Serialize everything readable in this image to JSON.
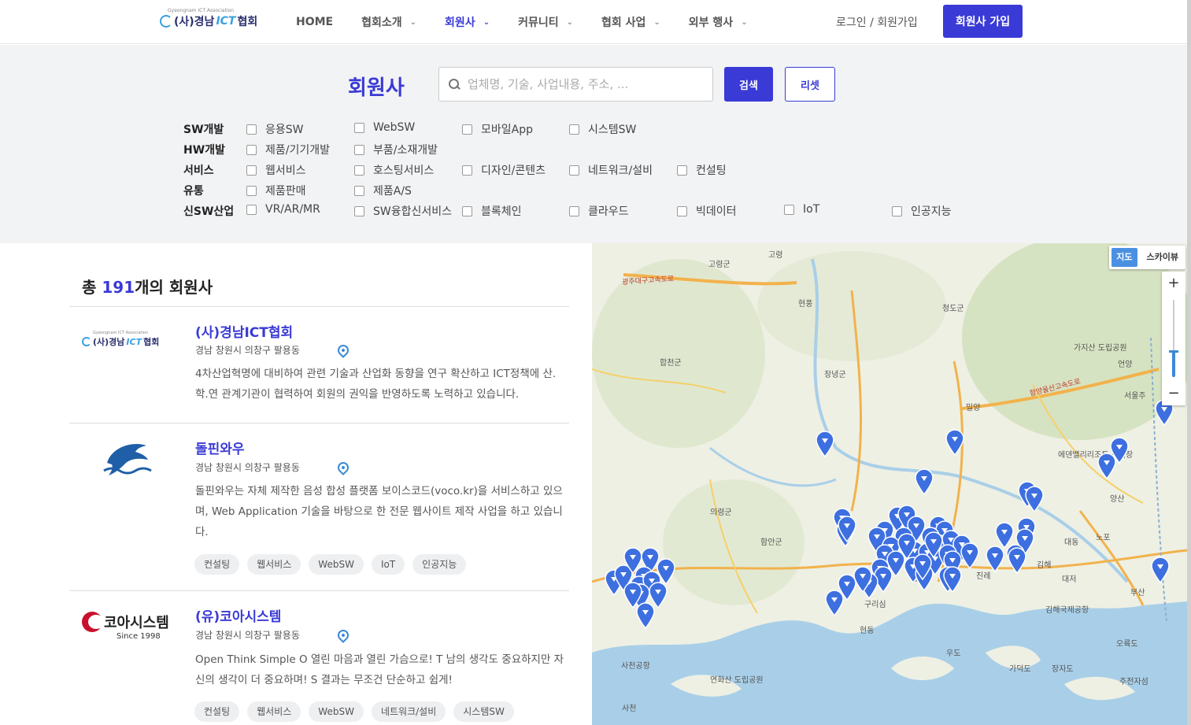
{
  "header": {
    "logo_sub": "Gyeongnam ICT Association",
    "logo_pre": "(사)경남",
    "logo_ict": "ICT",
    "logo_post": "협회",
    "nav": [
      {
        "label": "HOME",
        "has_menu": false,
        "active": false
      },
      {
        "label": "협회소개",
        "has_menu": true,
        "active": false
      },
      {
        "label": "회원사",
        "has_menu": true,
        "active": true
      },
      {
        "label": "커뮤니티",
        "has_menu": true,
        "active": false
      },
      {
        "label": "협회 사업",
        "has_menu": true,
        "active": false
      },
      {
        "label": "외부 행사",
        "has_menu": true,
        "active": false
      }
    ],
    "login_label": "로그인 / 회원가입",
    "join_label": "회원사 가입",
    "accent": "#3a3ad6"
  },
  "filter": {
    "title": "회원사",
    "search_placeholder": "업체명, 기술, 사업내용, 주소, ...",
    "search_value": "",
    "search_label": "검색",
    "reset_label": "리셋",
    "categories": [
      {
        "label": "SW개발",
        "options": [
          "응용SW",
          "WebSW",
          "모바일App",
          "시스템SW"
        ]
      },
      {
        "label": "HW개발",
        "options": [
          "제품/기기개발",
          "부품/소재개발"
        ]
      },
      {
        "label": "서비스",
        "options": [
          "웹서비스",
          "호스팅서비스",
          "디자인/콘텐츠",
          "네트워크/설비",
          "컨설팅"
        ]
      },
      {
        "label": "유통",
        "options": [
          "제품판매",
          "제품A/S"
        ]
      },
      {
        "label": "신SW산업",
        "options": [
          "VR/AR/MR",
          "SW융합신서비스",
          "블록체인",
          "클라우드",
          "빅데이터",
          "IoT",
          "인공지능"
        ]
      }
    ]
  },
  "list": {
    "total_prefix": "총 ",
    "total_count": "191",
    "total_suffix": "개의 회원사",
    "items": [
      {
        "name": "(사)경남ICT협회",
        "address": "경남 창원시 의창구 팔용동",
        "desc": "4차산업혁명에 대비하여 관련 기술과 산업화 동향을 연구 확산하고 ICT정책에 산.학.연 관계기관이 협력하여 회원의 권익을 반영하도록 노력하고 있습니다.",
        "tags": []
      },
      {
        "name": "돌핀와우",
        "address": "경남 창원시 의창구 팔용동",
        "desc": "돌핀와우는 자체 제작한 음성 합성 플랫폼 보이스코드(voco.kr)을 서비스하고 있으며, Web Application 기술을 바탕으로 한 전문 웹사이트 제작 사업을 하고 있습니다.",
        "tags": [
          "컨설팅",
          "웹서비스",
          "WebSW",
          "IoT",
          "인공지능"
        ]
      },
      {
        "name": "(유)코아시스템",
        "address": "경남 창원시 의창구 팔용동",
        "desc": "Open Think Simple O 열린 마음과 열린 가슴으로! T 남의 생각도 중요하지만 자신의 생각이 더 중요하며! S 결과는 무조건 단순하고 쉽게!",
        "tags": [
          "컨설팅",
          "웹서비스",
          "WebSW",
          "네트워크/설비",
          "시스템SW"
        ],
        "logo_text": "코아시스템",
        "logo_since": "Since 1998"
      }
    ]
  },
  "map": {
    "type_map": "지도",
    "type_sky": "스카이뷰",
    "zoom_in": "+",
    "zoom_out": "−",
    "labels": [
      {
        "t": "고령군"
      },
      {
        "t": "고령"
      },
      {
        "t": "현풍"
      },
      {
        "t": "청도군"
      },
      {
        "t": "합천군"
      },
      {
        "t": "창녕군"
      },
      {
        "t": "밀양"
      },
      {
        "t": "가지산 도립공원"
      },
      {
        "t": "언양"
      },
      {
        "t": "서울주"
      },
      {
        "t": "에덴밸리리조트 스키장"
      },
      {
        "t": "양산"
      },
      {
        "t": "의령군"
      },
      {
        "t": "함안군"
      },
      {
        "t": "대동"
      },
      {
        "t": "노포"
      },
      {
        "t": "김해"
      },
      {
        "t": "진례"
      },
      {
        "t": "대저"
      },
      {
        "t": "부산"
      },
      {
        "t": "구리심"
      },
      {
        "t": "창원"
      },
      {
        "t": "김해국제공항"
      },
      {
        "t": "현동"
      },
      {
        "t": "사천공항"
      },
      {
        "t": "연화산 도립공원"
      },
      {
        "t": "사천"
      },
      {
        "t": "우도"
      },
      {
        "t": "가덕도"
      },
      {
        "t": "장자도"
      },
      {
        "t": "오륙도"
      },
      {
        "t": "주전자섬"
      },
      {
        "t": "광주대구고속도로"
      },
      {
        "t": "함양울산고속도로"
      }
    ],
    "pin_color": "#3d6fe0"
  }
}
